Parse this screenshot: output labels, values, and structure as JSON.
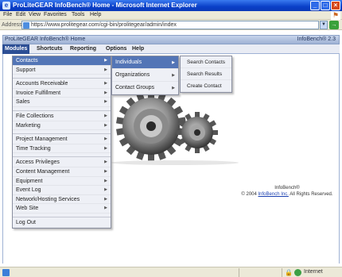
{
  "window": {
    "title": "ProLiteGEAR  InfoBench® Home - Microsoft Internet Explorer",
    "controls": {
      "minimize": "_",
      "maximize": "□",
      "close": "×"
    }
  },
  "menubar": {
    "items": [
      "File",
      "Edit",
      "View",
      "Favorites",
      "Tools",
      "Help"
    ]
  },
  "address": {
    "label": "Address",
    "url": "https://www.prolitegear.com/cgi-bin/prolitegear/admin/index",
    "go": "Go"
  },
  "app": {
    "title": "ProLiteGEAR  InfoBench® Home",
    "version": "InfoBench® 2.3",
    "tabs": [
      {
        "label": "Modules",
        "active": true
      },
      {
        "label": "Shortcuts",
        "active": false
      },
      {
        "label": "Reporting",
        "active": false
      },
      {
        "label": "Options",
        "active": false
      },
      {
        "label": "Help",
        "active": false
      }
    ]
  },
  "menu_l1": {
    "items": [
      {
        "label": "Contacts",
        "has_submenu": true,
        "highlight": true
      },
      {
        "label": "Support",
        "has_submenu": true
      },
      {
        "gap": true
      },
      {
        "label": "Accounts Receivable",
        "has_submenu": true
      },
      {
        "label": "Invoice Fulfillment",
        "has_submenu": true
      },
      {
        "label": "Sales",
        "has_submenu": true
      },
      {
        "gap": true
      },
      {
        "label": "File Collections",
        "has_submenu": true
      },
      {
        "label": "Marketing",
        "has_submenu": true
      },
      {
        "gap": true
      },
      {
        "label": "Project Management",
        "has_submenu": true
      },
      {
        "label": "Time Tracking",
        "has_submenu": true
      },
      {
        "gap": true
      },
      {
        "label": "Access Privileges",
        "has_submenu": true
      },
      {
        "label": "Content Management",
        "has_submenu": true
      },
      {
        "label": "Equipment",
        "has_submenu": true
      },
      {
        "label": "Event Log",
        "has_submenu": true
      },
      {
        "label": "Network/Hosting Services",
        "has_submenu": true
      },
      {
        "label": "Web Site",
        "has_submenu": true
      },
      {
        "gap": true
      },
      {
        "label": "Log Out",
        "has_submenu": false
      }
    ]
  },
  "menu_l2": {
    "items": [
      {
        "label": "Individuals",
        "has_submenu": true,
        "highlight": true
      },
      {
        "label": "Organizations",
        "has_submenu": true
      },
      {
        "label": "Contact Groups",
        "has_submenu": true
      }
    ]
  },
  "menu_l3": {
    "items": [
      {
        "label": "Search Contacts"
      },
      {
        "label": "Search Results"
      },
      {
        "label": "Create Contact"
      }
    ]
  },
  "copyright": {
    "line1": "InfoBench®",
    "prefix": "© 2004 ",
    "link": "InfoBench Inc.",
    "suffix": " All Rights Reserved."
  },
  "status": {
    "zone": "Internet"
  },
  "colors": {
    "titlebar": "#0a3fc8",
    "menu_highlight": "#5375b6",
    "active_tab": "#2d4f95"
  }
}
